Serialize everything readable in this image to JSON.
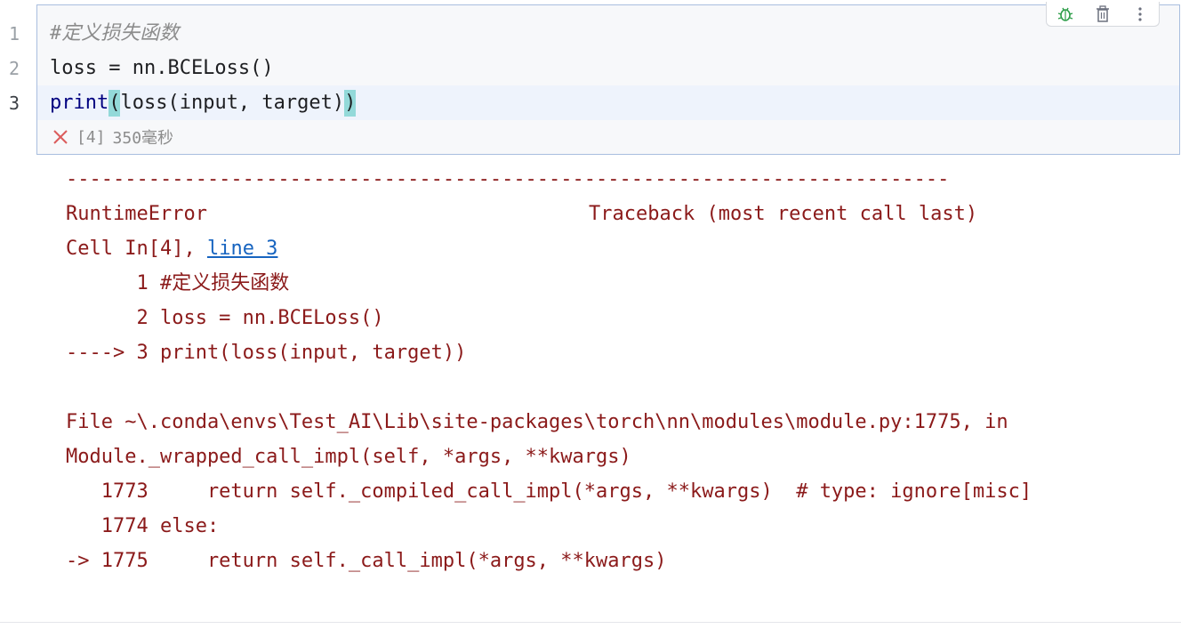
{
  "cell": {
    "line_numbers": [
      "1",
      "2",
      "3"
    ],
    "lines": {
      "l1": "#定义损失函数",
      "l2": "loss = nn.BCELoss()",
      "l3_fn": "print",
      "l3_open": "(",
      "l3_mid": "loss(input, target)",
      "l3_close": ")"
    },
    "exec_count": "[4]",
    "exec_time": "350毫秒",
    "status_color": "#db5c5c"
  },
  "toolbar": {
    "icons": [
      "debug-icon",
      "trash-icon",
      "more-icon"
    ]
  },
  "output": {
    "separator": "---------------------------------------------------------------------------",
    "error_name": "RuntimeError",
    "traceback_header": "Traceback (most recent call last)",
    "cell_ref_prefix": "Cell In[4], ",
    "cell_ref_link": "line 3",
    "tb_line1": "      1 #定义损失函数",
    "tb_line2": "      2 loss = nn.BCELoss()",
    "tb_line3": "----> 3 print(loss(input, target))",
    "file_line1": "File ~\\.conda\\envs\\Test_AI\\Lib\\site-packages\\torch\\nn\\modules\\module.py:1775, in",
    "file_line2": "Module._wrapped_call_impl(self, *args, **kwargs)",
    "src1773": "   1773     return self._compiled_call_impl(*args, **kwargs)  # type: ignore[misc]",
    "src1774": "   1774 else:",
    "src1775": "-> 1775     return self._call_impl(*args, **kwargs)"
  }
}
